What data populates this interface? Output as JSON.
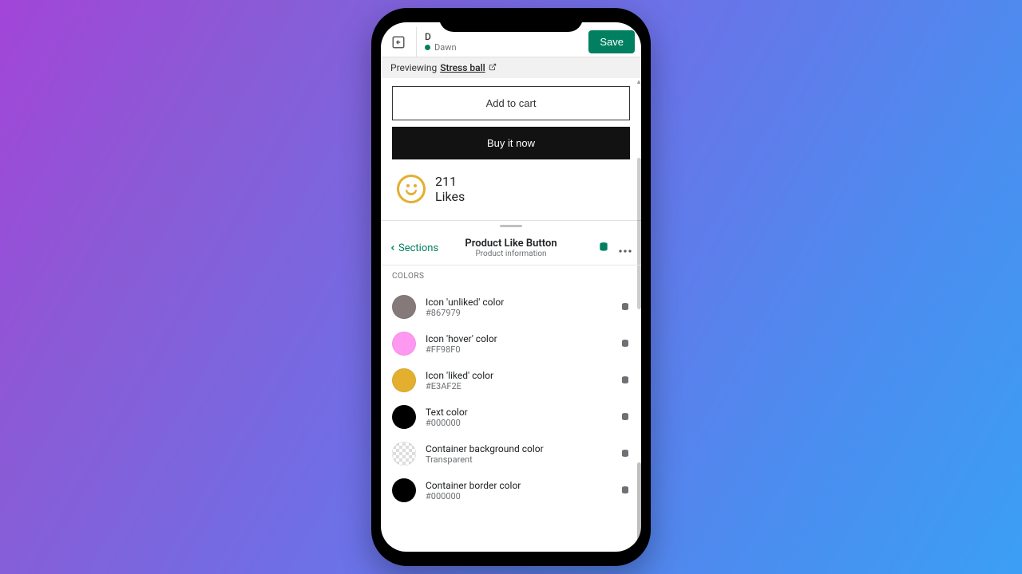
{
  "header": {
    "title_partial": "D",
    "theme_name": "Dawn",
    "save_label": "Save"
  },
  "previewing": {
    "prefix": "Previewing",
    "product_name": "Stress ball"
  },
  "preview": {
    "add_to_cart": "Add to cart",
    "buy_now": "Buy it now",
    "likes_count": "211",
    "likes_label": "Likes"
  },
  "panel": {
    "back_label": "Sections",
    "title": "Product Like Button",
    "subtitle": "Product information"
  },
  "colors": {
    "section_title": "COLORS",
    "items": [
      {
        "label": "Icon 'unliked' color",
        "value": "#867979",
        "swatch": "#867979"
      },
      {
        "label": "Icon 'hover' color",
        "value": "#FF98F0",
        "swatch": "#FF98F0"
      },
      {
        "label": "Icon 'liked' color",
        "value": "#E3AF2E",
        "swatch": "#E3AF2E"
      },
      {
        "label": "Text color",
        "value": "#000000",
        "swatch": "#000000"
      },
      {
        "label": "Container background color",
        "value": "Transparent",
        "swatch": "transparent"
      },
      {
        "label": "Container border color",
        "value": "#000000",
        "swatch": "#000000"
      }
    ]
  }
}
